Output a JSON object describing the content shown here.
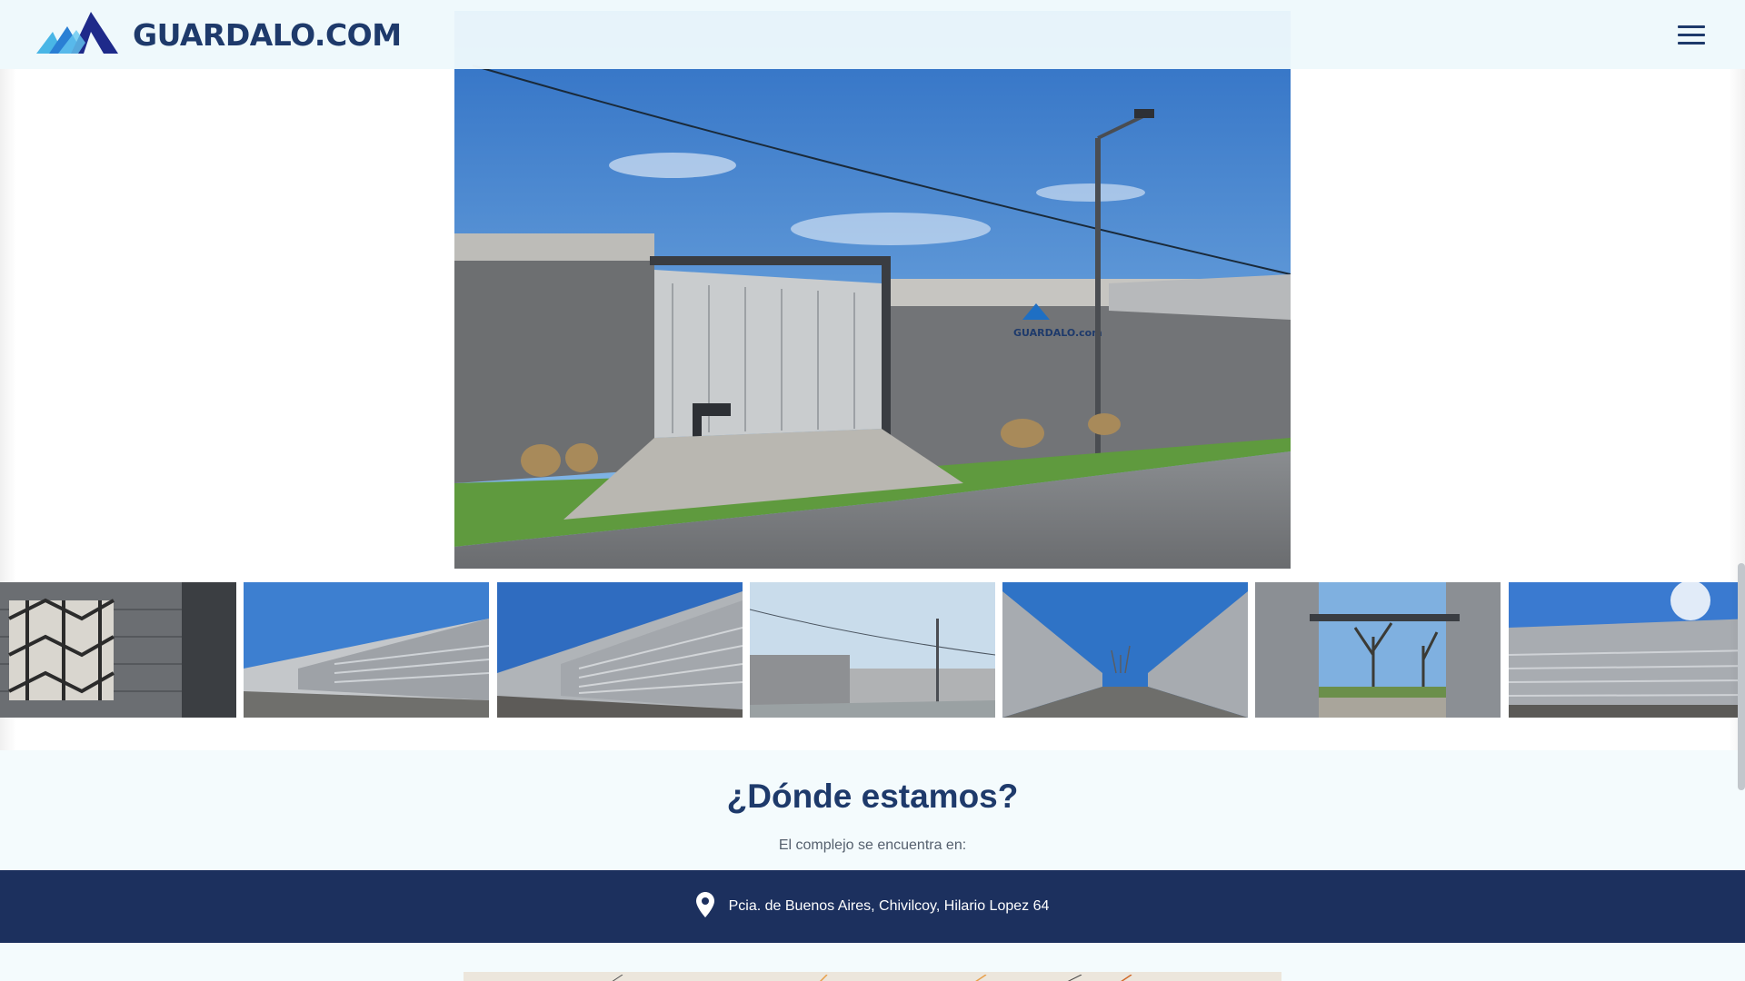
{
  "header": {
    "brand_name": "GUARDALO.COM",
    "logo_icon": "mountain-logo-icon",
    "menu_icon": "hamburger-menu-icon"
  },
  "gallery": {
    "main_photo": "storage-facility-entrance-photo",
    "main_photo_sign": "GUARDALO.com",
    "thumbnails": [
      {
        "name": "thumb-wall-lamp"
      },
      {
        "name": "thumb-storage-row-1"
      },
      {
        "name": "thumb-storage-row-2"
      },
      {
        "name": "thumb-entrance-wide"
      },
      {
        "name": "thumb-storage-aisle"
      },
      {
        "name": "thumb-gate-trees"
      },
      {
        "name": "thumb-storage-sun"
      }
    ]
  },
  "location": {
    "title": "¿Dónde estamos?",
    "subtitle": "El complejo se encuentra en:",
    "address": "Pcia. de Buenos Aires, Chivilcoy, Hilario Lopez 64",
    "pin_icon": "map-pin-icon"
  },
  "colors": {
    "brand_navy": "#1e3a6b",
    "address_bar": "#1c305e",
    "header_bg": "#eef9fc",
    "sky": "#4a8fd6"
  }
}
